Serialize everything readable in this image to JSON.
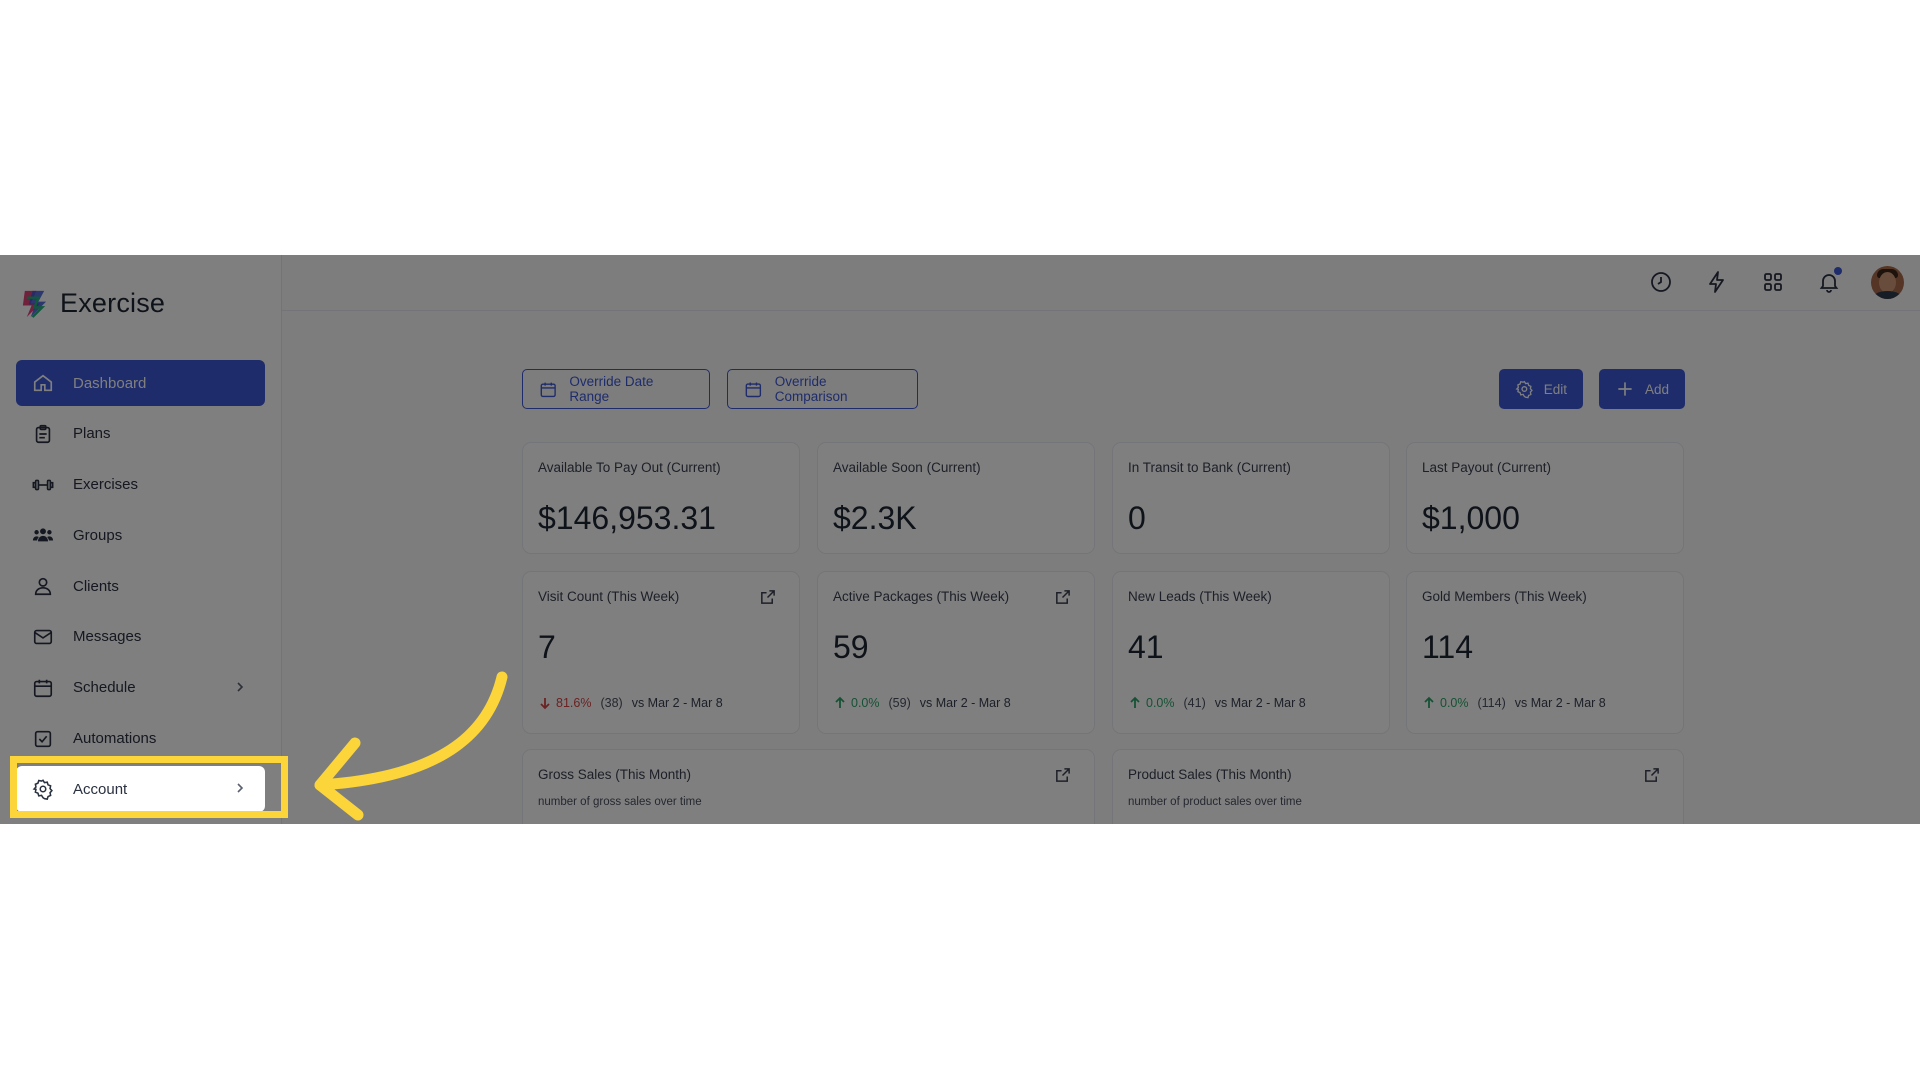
{
  "app": {
    "name": "Exercise"
  },
  "sidebar": {
    "items": [
      {
        "label": "Dashboard",
        "icon": "home-icon",
        "active": true
      },
      {
        "label": "Plans",
        "icon": "clipboard-icon"
      },
      {
        "label": "Exercises",
        "icon": "dumbbell-icon"
      },
      {
        "label": "Groups",
        "icon": "users-icon"
      },
      {
        "label": "Clients",
        "icon": "user-icon"
      },
      {
        "label": "Messages",
        "icon": "mail-icon"
      },
      {
        "label": "Schedule",
        "icon": "calendar-icon",
        "has_chevron": true
      },
      {
        "label": "Automations",
        "icon": "checkbox-icon"
      },
      {
        "label": "Account",
        "icon": "gear-icon",
        "has_chevron": true,
        "highlighted": true
      }
    ]
  },
  "topbar": {
    "icons": [
      "clock-icon",
      "bolt-icon",
      "grid-icon",
      "bell-icon"
    ],
    "has_notification": true
  },
  "toolbar": {
    "override_date_range": "Override Date Range",
    "override_comparison": "Override Comparison",
    "edit": "Edit",
    "add": "Add"
  },
  "stats_row1": [
    {
      "title": "Available To Pay Out (Current)",
      "value": "$146,953.31"
    },
    {
      "title": "Available Soon (Current)",
      "value": "$2.3K"
    },
    {
      "title": "In Transit to Bank (Current)",
      "value": "0"
    },
    {
      "title": "Last Payout (Current)",
      "value": "$1,000"
    }
  ],
  "stats_row2": [
    {
      "title": "Visit Count (This Week)",
      "value": "7",
      "direction": "down",
      "pct": "81.6%",
      "count": "(38)",
      "compare": "vs Mar 2 - Mar 8"
    },
    {
      "title": "Active Packages (This Week)",
      "value": "59",
      "direction": "up",
      "pct": "0.0%",
      "count": "(59)",
      "compare": "vs Mar 2 - Mar 8"
    },
    {
      "title": "New Leads (This Week)",
      "value": "41",
      "direction": "up",
      "pct": "0.0%",
      "count": "(41)",
      "compare": "vs Mar 2 - Mar 8"
    },
    {
      "title": "Gold Members (This Week)",
      "value": "114",
      "direction": "up",
      "pct": "0.0%",
      "count": "(114)",
      "compare": "vs Mar 2 - Mar 8"
    }
  ],
  "charts": [
    {
      "title": "Gross Sales (This Month)",
      "subtitle": "number of gross sales over time"
    },
    {
      "title": "Product Sales (This Month)",
      "subtitle": "number of product sales over time"
    }
  ],
  "colors": {
    "accent": "#3c58d6",
    "up": "#2fa36b",
    "down": "#d64545",
    "highlight": "#fcd53b"
  }
}
